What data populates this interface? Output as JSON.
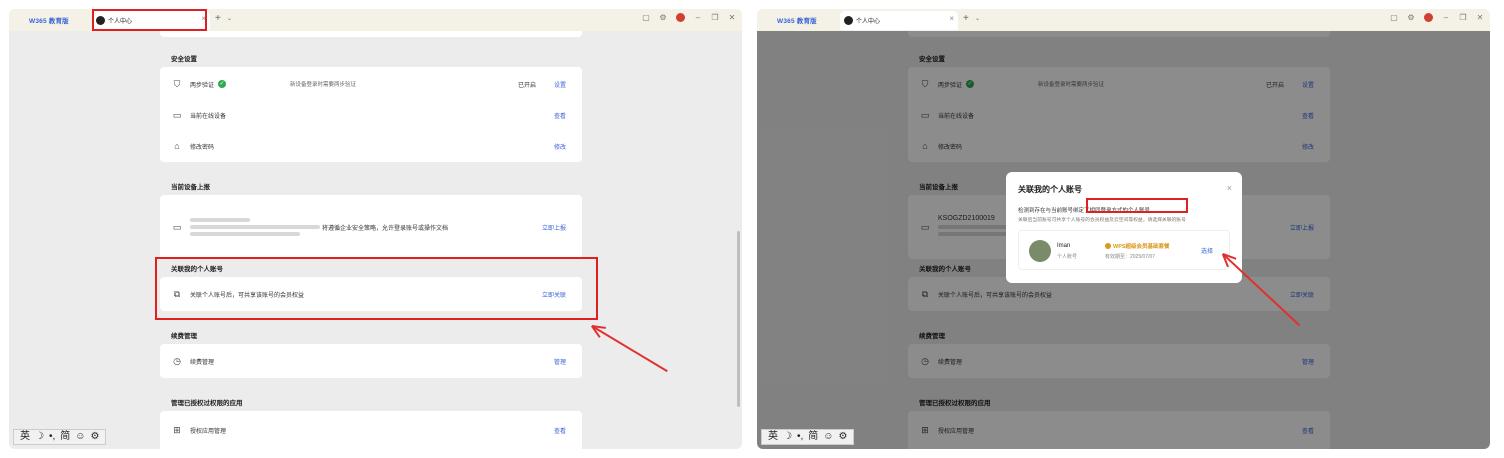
{
  "browser": {
    "brand": "W365 教育版",
    "tab_title": "个人中心",
    "tab_close": "×",
    "tab_add": "+",
    "tab_more": "⌄"
  },
  "sections": {
    "security": {
      "title": "安全设置",
      "two_step": {
        "label": "两步验证",
        "desc": "新设备登录时需要两步验证",
        "status": "已开启",
        "action": "设置"
      },
      "devices": {
        "label": "当前在线设备",
        "action": "查看"
      },
      "password": {
        "label": "修改密码",
        "action": "修改"
      }
    },
    "report": {
      "title": "当前设备上报",
      "device_id": "KSOGZD2100019",
      "desc": "将遵循企业安全策略，允许登录账号或操作文档",
      "action": "立即上报"
    },
    "personal": {
      "title": "关联我的个人账号",
      "desc": "关联个人账号后，可共享该账号的会员权益",
      "action": "立即关联"
    },
    "renewal": {
      "title": "续费管理",
      "label": "续费管理",
      "action": "管理"
    },
    "apps": {
      "title": "管理已授权过权限的应用",
      "label": "授权应用管理",
      "action": "查看"
    }
  },
  "ime": [
    "英",
    "☽",
    "•,",
    "简",
    "☺",
    "⚙"
  ],
  "modal": {
    "title": "关联我的个人账号",
    "close": "×",
    "desc_line1": "检测到存在与当前账号绑定了相同登录方式的个人账号",
    "desc_line2": "关联后当前账号可共享个人账号的会员权益及云空间等权益，请选择关联的账号",
    "account": {
      "name": "Iman",
      "type": "个人账号",
      "badge": "WPS超级会员基础套餐",
      "expiry": "有效期至：2025/07/07",
      "select": "选择"
    }
  },
  "colors": {
    "accent": "#3a64d8",
    "annotation": "#e02020",
    "success": "#2fa84f",
    "badge": "#d9991a"
  }
}
